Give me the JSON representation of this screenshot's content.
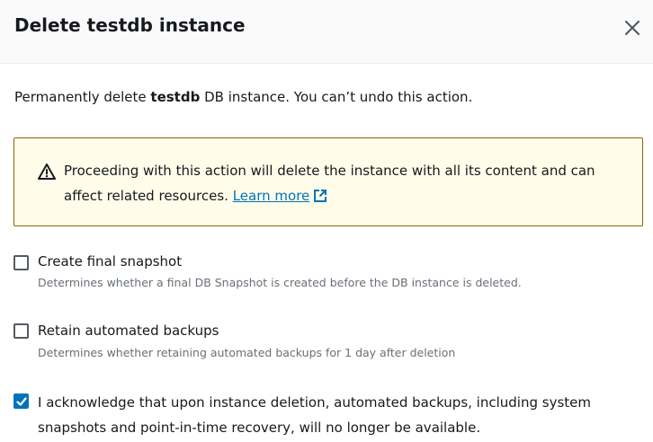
{
  "modal": {
    "title": "Delete testdb instance",
    "close_icon": "close-icon"
  },
  "intro": {
    "prefix": "Permanently delete ",
    "instance_name": "testdb",
    "suffix": " DB instance. You can’t undo this action."
  },
  "alert": {
    "icon": "warning-icon",
    "text": "Proceeding with this action will delete the instance with all its content and can affect related resources. ",
    "link_label": "Learn more",
    "link_icon": "external-link-icon"
  },
  "options": {
    "final_snapshot": {
      "label": "Create final snapshot",
      "description": "Determines whether a final DB Snapshot is created before the DB instance is deleted.",
      "checked": false
    },
    "retain_backups": {
      "label": "Retain automated backups",
      "description": "Determines whether retaining automated backups for 1 day after deletion",
      "checked": false
    },
    "acknowledge": {
      "label": "I acknowledge that upon instance deletion, automated backups, including system snapshots and point-in-time recovery, will no longer be available.",
      "checked": true
    }
  },
  "colors": {
    "accent": "#0073bb",
    "warning_border": "#8d6605",
    "warning_bg": "#fffce9"
  }
}
